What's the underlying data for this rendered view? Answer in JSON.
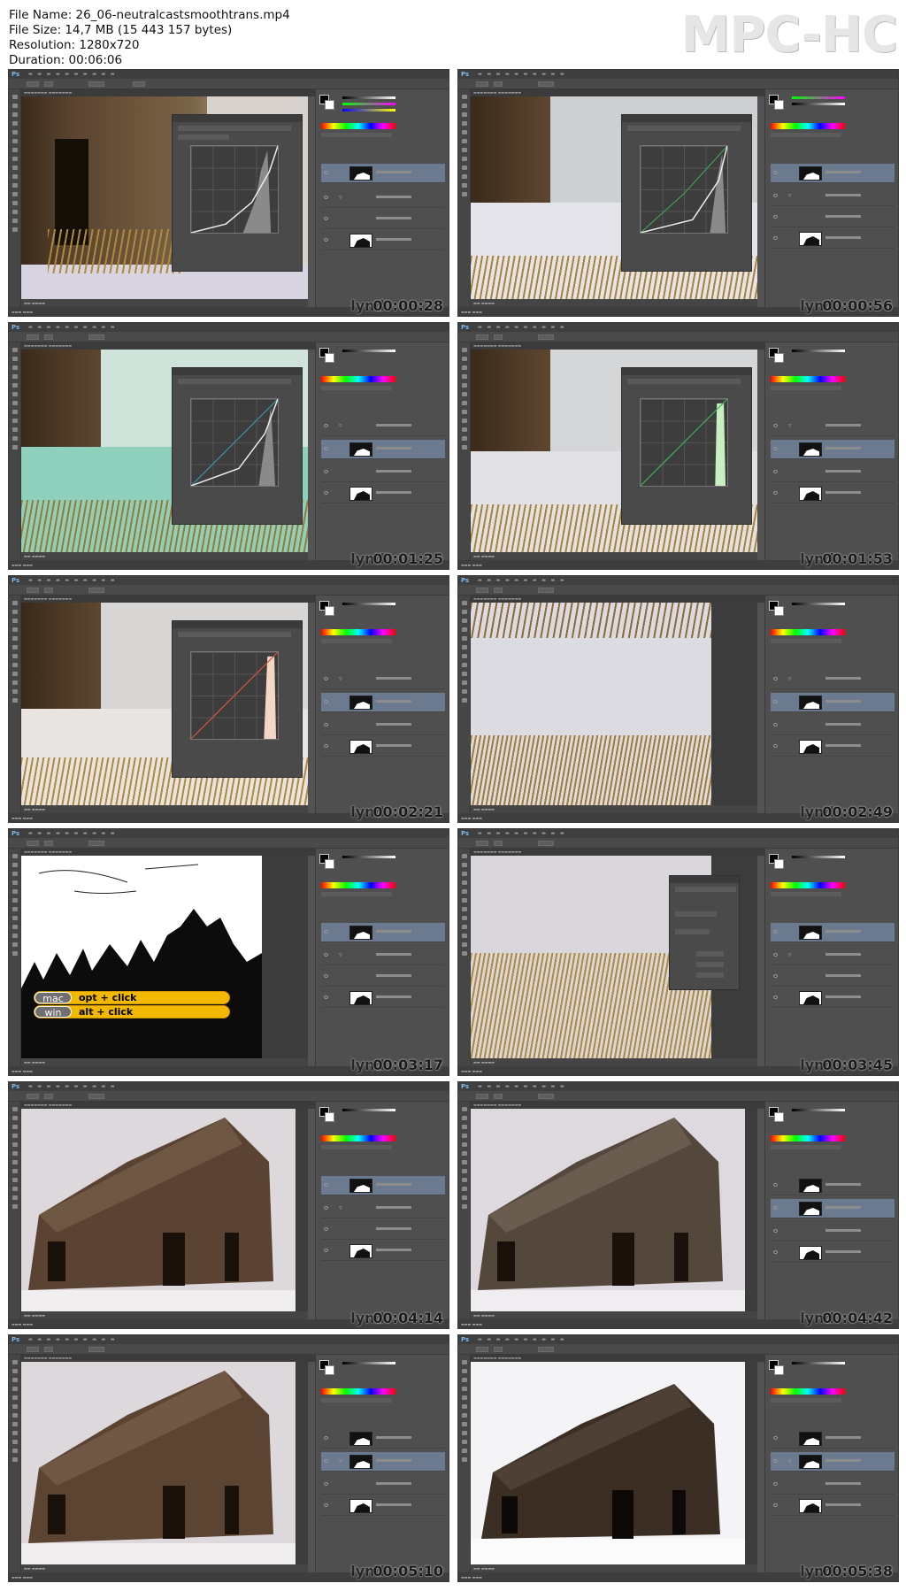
{
  "info": {
    "file_name": "File Name: 26_06-neutralcastsmoothtrans.mp4",
    "file_size": "File Size: 14,7 MB (15 443 157 bytes)",
    "resolution": "Resolution: 1280x720",
    "duration": "Duration: 00:06:06"
  },
  "brand": {
    "logo": "MPC-HC"
  },
  "watermark": {
    "text": "lynd"
  },
  "shortcut": {
    "mac_label": "mac",
    "mac_keys": "opt + click",
    "win_label": "win",
    "win_keys": "alt + click"
  },
  "thumbnails": [
    {
      "timestamp": "00:00:28"
    },
    {
      "timestamp": "00:00:56"
    },
    {
      "timestamp": "00:01:25"
    },
    {
      "timestamp": "00:01:53"
    },
    {
      "timestamp": "00:02:21"
    },
    {
      "timestamp": "00:02:49"
    },
    {
      "timestamp": "00:03:17"
    },
    {
      "timestamp": "00:03:45"
    },
    {
      "timestamp": "00:04:14"
    },
    {
      "timestamp": "00:04:42"
    },
    {
      "timestamp": "00:05:10"
    },
    {
      "timestamp": "00:05:38"
    }
  ],
  "colors": {
    "background": "#ffffff",
    "ps_ui": "#535353",
    "layer_selected": "#6b7a8e",
    "shortcut_yellow": "#f2b900",
    "logo_grey": "#e6e6e6"
  }
}
